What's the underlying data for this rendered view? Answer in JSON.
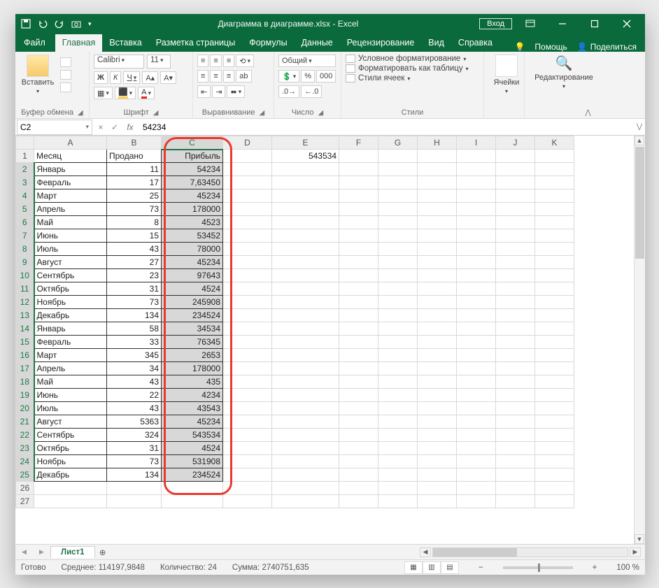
{
  "title": "Диаграмма в диаграмме.xlsx  -  Excel",
  "login": "Вход",
  "tabs": {
    "file": "Файл",
    "items": [
      "Главная",
      "Вставка",
      "Разметка страницы",
      "Формулы",
      "Данные",
      "Рецензирование",
      "Вид",
      "Справка"
    ],
    "active": 0,
    "help": "Помощь",
    "share": "Поделиться"
  },
  "ribbon": {
    "clipboard": {
      "paste": "Вставить",
      "label": "Буфер обмена"
    },
    "font": {
      "name": "Calibri",
      "size": "11",
      "bold": "Ж",
      "italic": "К",
      "underline": "Ч",
      "label": "Шрифт"
    },
    "align": {
      "label": "Выравнивание"
    },
    "number": {
      "format": "Общий",
      "label": "Число"
    },
    "styles": {
      "cond": "Условное форматирование",
      "table": "Форматировать как таблицу",
      "cell": "Стили ячеек",
      "label": "Стили"
    },
    "cells": {
      "label": "Ячейки"
    },
    "editing": {
      "label": "Редактирование"
    }
  },
  "formula": {
    "cell": "C2",
    "value": "54234"
  },
  "columns": [
    "A",
    "B",
    "C",
    "D",
    "E",
    "F",
    "G",
    "H",
    "I",
    "J",
    "K"
  ],
  "headers": {
    "A": "Месяц",
    "B": "Продано",
    "C": "Прибыль"
  },
  "e1": "543534",
  "rows": [
    {
      "a": "Январь",
      "b": "11",
      "c": "54234"
    },
    {
      "a": "Февраль",
      "b": "17",
      "c": "7,63450"
    },
    {
      "a": "Март",
      "b": "25",
      "c": "45234"
    },
    {
      "a": "Апрель",
      "b": "73",
      "c": "178000"
    },
    {
      "a": "Май",
      "b": "8",
      "c": "4523"
    },
    {
      "a": "Июнь",
      "b": "15",
      "c": "53452"
    },
    {
      "a": "Июль",
      "b": "43",
      "c": "78000"
    },
    {
      "a": "Август",
      "b": "27",
      "c": "45234"
    },
    {
      "a": "Сентябрь",
      "b": "23",
      "c": "97643"
    },
    {
      "a": "Октябрь",
      "b": "31",
      "c": "4524"
    },
    {
      "a": "Ноябрь",
      "b": "73",
      "c": "245908"
    },
    {
      "a": "Декабрь",
      "b": "134",
      "c": "234524"
    },
    {
      "a": "Январь",
      "b": "58",
      "c": "34534"
    },
    {
      "a": "Февраль",
      "b": "33",
      "c": "76345"
    },
    {
      "a": "Март",
      "b": "345",
      "c": "2653"
    },
    {
      "a": "Апрель",
      "b": "34",
      "c": "178000"
    },
    {
      "a": "Май",
      "b": "43",
      "c": "435"
    },
    {
      "a": "Июнь",
      "b": "22",
      "c": "4234"
    },
    {
      "a": "Июль",
      "b": "43",
      "c": "43543"
    },
    {
      "a": "Август",
      "b": "5363",
      "c": "45234"
    },
    {
      "a": "Сентябрь",
      "b": "324",
      "c": "543534"
    },
    {
      "a": "Октябрь",
      "b": "31",
      "c": "4524"
    },
    {
      "a": "Ноябрь",
      "b": "73",
      "c": "531908"
    },
    {
      "a": "Декабрь",
      "b": "134",
      "c": "234524"
    }
  ],
  "sheet_tab": "Лист1",
  "status": {
    "ready": "Готово",
    "avg_label": "Среднее:",
    "avg": "114197,9848",
    "count_label": "Количество:",
    "count": "24",
    "sum_label": "Сумма:",
    "sum": "2740751,635",
    "zoom": "100 %"
  }
}
